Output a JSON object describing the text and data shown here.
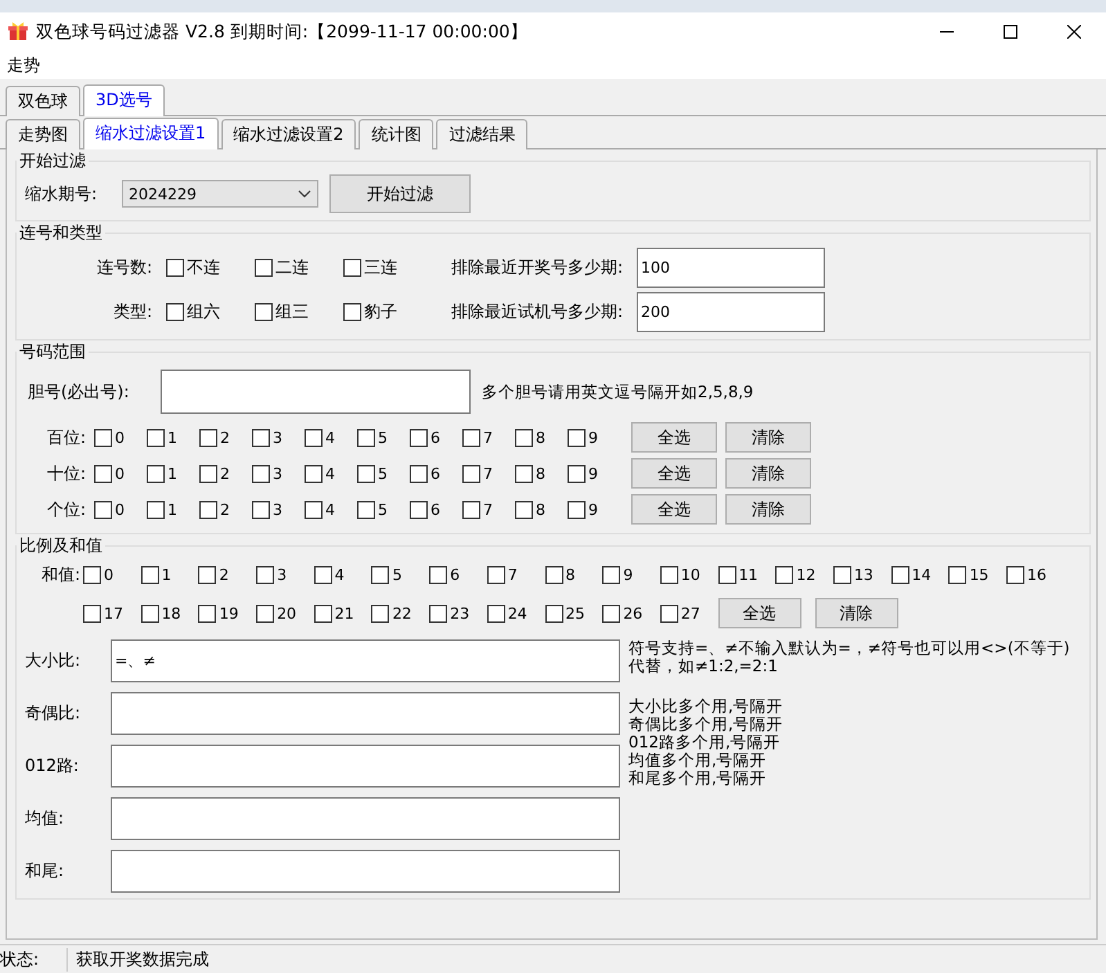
{
  "window": {
    "title": "双色球号码过滤器 V2.8 到期时间:【2099-11-17 00:00:00】"
  },
  "menu": [
    "走势"
  ],
  "outer_tabs": [
    {
      "label": "双色球",
      "selected": false
    },
    {
      "label": "3D选号",
      "selected": true
    }
  ],
  "inner_tabs": [
    {
      "label": "走势图",
      "selected": false
    },
    {
      "label": "缩水过滤设置1",
      "selected": true
    },
    {
      "label": "缩水过滤设置2",
      "selected": false
    },
    {
      "label": "统计图",
      "selected": false
    },
    {
      "label": "过滤结果",
      "selected": false
    }
  ],
  "start_filter": {
    "title": "开始过滤",
    "issue_label": "缩水期号:",
    "issue_value": "2024229",
    "start_button": "开始过滤"
  },
  "consecutive": {
    "title": "连号和类型",
    "rows": [
      {
        "label": "连号数:",
        "options": [
          {
            "label": "不连",
            "checked": false
          },
          {
            "label": "二连",
            "checked": false
          },
          {
            "label": "三连",
            "checked": false
          }
        ],
        "field_label": "排除最近开奖号多少期:",
        "field_value": "100"
      },
      {
        "label": "类型:",
        "options": [
          {
            "label": "组六",
            "checked": false
          },
          {
            "label": "组三",
            "checked": false
          },
          {
            "label": "豹子",
            "checked": false
          }
        ],
        "field_label": "排除最近试机号多少期:",
        "field_value": "200"
      }
    ]
  },
  "number_range": {
    "title": "号码范围",
    "bile_label": "胆号(必出号):",
    "bile_hint": "多个胆号请用英文逗号隔开如2,5,8,9",
    "positions": [
      {
        "label": "百位:",
        "digits": [
          {
            "label": "0",
            "checked": false
          },
          {
            "label": "1",
            "checked": false
          },
          {
            "label": "2",
            "checked": false
          },
          {
            "label": "3",
            "checked": false
          },
          {
            "label": "4",
            "checked": false
          },
          {
            "label": "5",
            "checked": false
          },
          {
            "label": "6",
            "checked": false
          },
          {
            "label": "7",
            "checked": false
          },
          {
            "label": "8",
            "checked": false
          },
          {
            "label": "9",
            "checked": false
          }
        ],
        "buttons": [
          "全选",
          "清除"
        ]
      },
      {
        "label": "十位:",
        "digits": [
          {
            "label": "0",
            "checked": false
          },
          {
            "label": "1",
            "checked": false
          },
          {
            "label": "2",
            "checked": false
          },
          {
            "label": "3",
            "checked": false
          },
          {
            "label": "4",
            "checked": false
          },
          {
            "label": "5",
            "checked": false
          },
          {
            "label": "6",
            "checked": false
          },
          {
            "label": "7",
            "checked": false
          },
          {
            "label": "8",
            "checked": false
          },
          {
            "label": "9",
            "checked": false
          }
        ],
        "buttons": [
          "全选",
          "清除"
        ]
      },
      {
        "label": "个位:",
        "digits": [
          {
            "label": "0",
            "checked": false
          },
          {
            "label": "1",
            "checked": false
          },
          {
            "label": "2",
            "checked": false
          },
          {
            "label": "3",
            "checked": false
          },
          {
            "label": "4",
            "checked": false
          },
          {
            "label": "5",
            "checked": false
          },
          {
            "label": "6",
            "checked": false
          },
          {
            "label": "7",
            "checked": false
          },
          {
            "label": "8",
            "checked": false
          },
          {
            "label": "9",
            "checked": false
          }
        ],
        "buttons": [
          "全选",
          "清除"
        ]
      }
    ]
  },
  "ratio": {
    "title": "比例及和值",
    "sum_label": "和值:",
    "sums": [
      {
        "label": "0",
        "checked": false
      },
      {
        "label": "1",
        "checked": false
      },
      {
        "label": "2",
        "checked": false
      },
      {
        "label": "3",
        "checked": false
      },
      {
        "label": "4",
        "checked": false
      },
      {
        "label": "5",
        "checked": false
      },
      {
        "label": "6",
        "checked": false
      },
      {
        "label": "7",
        "checked": false
      },
      {
        "label": "8",
        "checked": false
      },
      {
        "label": "9",
        "checked": false
      },
      {
        "label": "10",
        "checked": false
      },
      {
        "label": "11",
        "checked": false
      },
      {
        "label": "12",
        "checked": false
      },
      {
        "label": "13",
        "checked": false
      },
      {
        "label": "14",
        "checked": false
      },
      {
        "label": "15",
        "checked": false
      },
      {
        "label": "16",
        "checked": false
      },
      {
        "label": "17",
        "checked": false
      },
      {
        "label": "18",
        "checked": false
      },
      {
        "label": "19",
        "checked": false
      },
      {
        "label": "20",
        "checked": false
      },
      {
        "label": "21",
        "checked": false
      },
      {
        "label": "22",
        "checked": false
      },
      {
        "label": "23",
        "checked": false
      },
      {
        "label": "24",
        "checked": false
      },
      {
        "label": "25",
        "checked": false
      },
      {
        "label": "26",
        "checked": false
      },
      {
        "label": "27",
        "checked": false
      }
    ],
    "sum_buttons": [
      "全选",
      "清除"
    ],
    "fields": [
      {
        "label": "大小比:",
        "value": "=、≠"
      },
      {
        "label": "奇偶比:"
      },
      {
        "label": "012路:"
      },
      {
        "label": "均值:"
      },
      {
        "label": "和尾:"
      }
    ],
    "symbol_note": "符号支持=、≠不输入默认为=，≠符号也可以用<>(不等于)代替，如≠1:2,=2:1",
    "usage_notes": [
      "大小比多个用,号隔开",
      "奇偶比多个用,号隔开",
      "012路多个用,号隔开",
      "均值多个用,号隔开",
      "和尾多个用,号隔开"
    ]
  },
  "status_bar": {
    "label": "状态:",
    "message": "获取开奖数据完成"
  }
}
